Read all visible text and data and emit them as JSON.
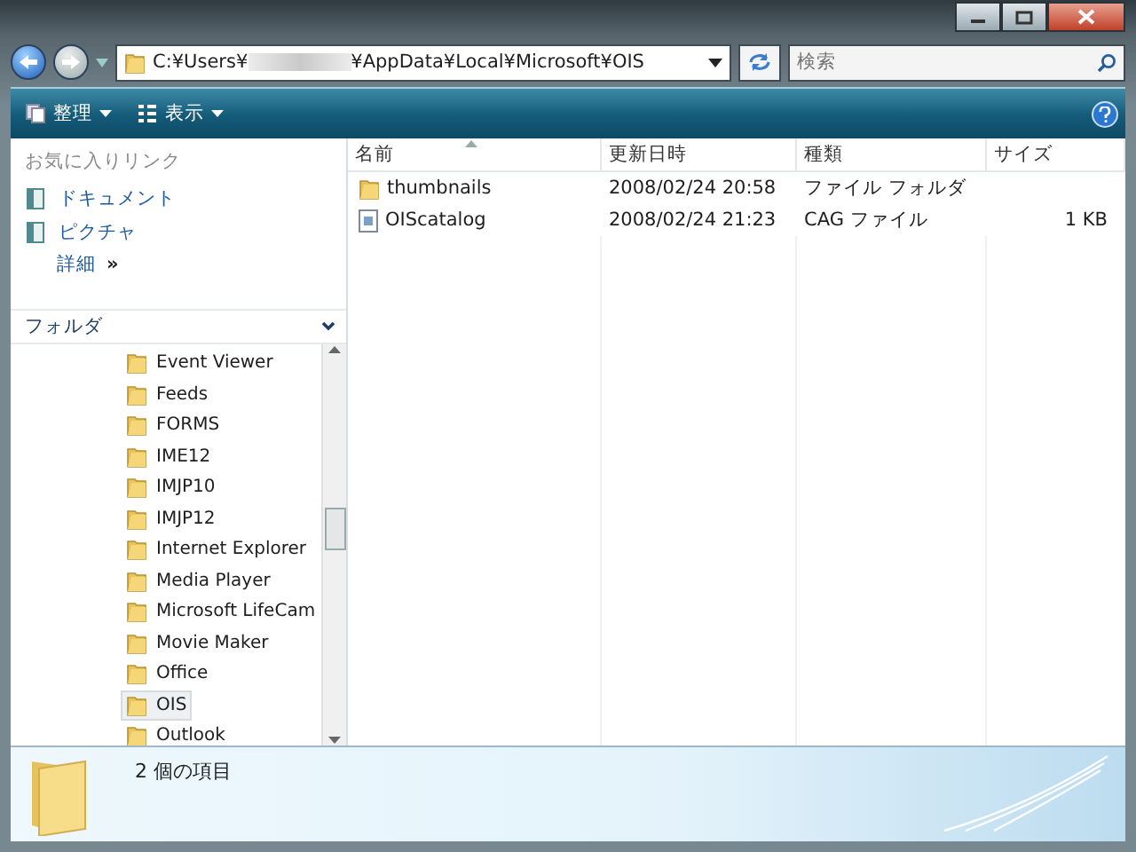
{
  "address": {
    "before": "C:¥Users¥",
    "after": "¥AppData¥Local¥Microsoft¥OIS"
  },
  "search": {
    "placeholder": "検索"
  },
  "toolbar": [
    {
      "label": "整理",
      "kind": "organize"
    },
    {
      "label": "表示",
      "kind": "views"
    }
  ],
  "favorites": {
    "title": "お気に入りリンク",
    "items": [
      {
        "label": "ドキュメント"
      },
      {
        "label": "ピクチャ"
      }
    ],
    "more": "詳細",
    "more_icon": "»"
  },
  "folders": {
    "title": "フォルダ",
    "items": [
      {
        "label": "Event Viewer",
        "selected": false
      },
      {
        "label": "Feeds",
        "selected": false
      },
      {
        "label": "FORMS",
        "selected": false
      },
      {
        "label": "IME12",
        "selected": false
      },
      {
        "label": "IMJP10",
        "selected": false
      },
      {
        "label": "IMJP12",
        "selected": false
      },
      {
        "label": "Internet Explorer",
        "selected": false
      },
      {
        "label": "Media Player",
        "selected": false
      },
      {
        "label": "Microsoft LifeCam",
        "selected": false
      },
      {
        "label": "Movie Maker",
        "selected": false
      },
      {
        "label": "Office",
        "selected": false
      },
      {
        "label": "OIS",
        "selected": true
      },
      {
        "label": "Outlook",
        "selected": false
      }
    ]
  },
  "table": {
    "columns": [
      "名前",
      "更新日時",
      "種類",
      "サイズ"
    ],
    "rows": [
      {
        "kind": "folder",
        "name": "thumbnails",
        "modified": "2008/02/24 20:58",
        "type": "ファイル フォルダ",
        "size": ""
      },
      {
        "kind": "file",
        "name": "OIScatalog",
        "modified": "2008/02/24 21:23",
        "type": "CAG ファイル",
        "size": "1 KB"
      }
    ]
  },
  "status": "2 個の項目"
}
